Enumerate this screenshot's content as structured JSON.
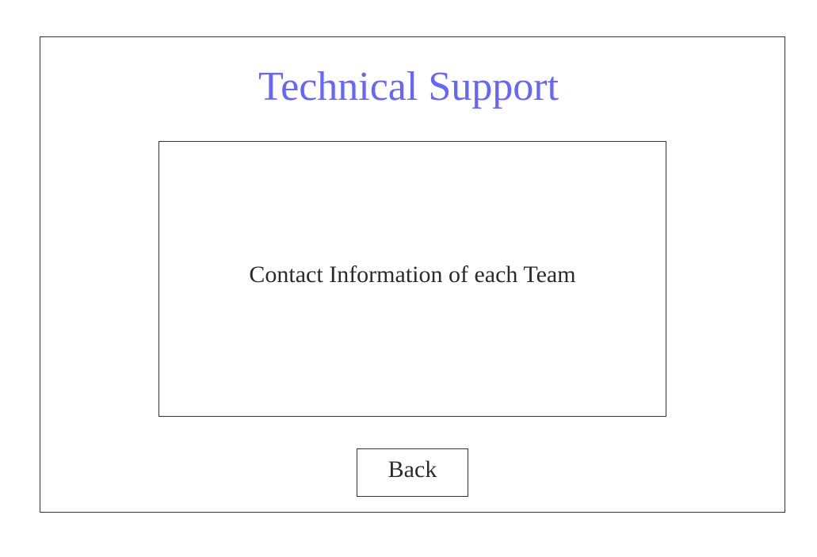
{
  "page": {
    "title": "Technical Support",
    "title_color": "#6666ff"
  },
  "content": {
    "text": "Contact Information of each Team"
  },
  "actions": {
    "back_label": "Back"
  }
}
